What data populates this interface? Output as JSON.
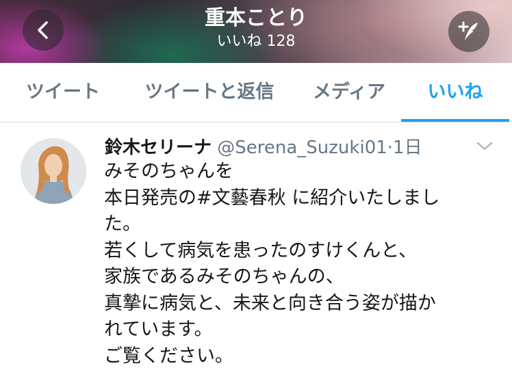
{
  "header": {
    "title": "重本ことり",
    "subtitle": "いいね 128"
  },
  "tabs": [
    {
      "label": "ツイート"
    },
    {
      "label": "ツイートと返信"
    },
    {
      "label": "メディア"
    },
    {
      "label": "いいね"
    }
  ],
  "active_tab": "いいね",
  "tweet": {
    "name": "鈴木セリーナ",
    "handle": "@Serena_Suzuki01",
    "separator": "·",
    "time": "1日",
    "lines": [
      "みそのちゃんを",
      "本日発売の#文藝春秋 に紹介いたしまし",
      "た。",
      "若くして病気を患ったのすけくんと、",
      "家族であるみそのちゃんの、",
      "真摯に病気と、未来と向き合う姿が描か",
      "れています。",
      "ご覧ください。"
    ]
  },
  "colors": {
    "accent": "#1da1f2",
    "secondary_text": "#657786",
    "primary_text": "#14171a"
  },
  "icons": [
    "back-arrow-icon",
    "compose-tweet-icon",
    "chevron-down-icon"
  ]
}
